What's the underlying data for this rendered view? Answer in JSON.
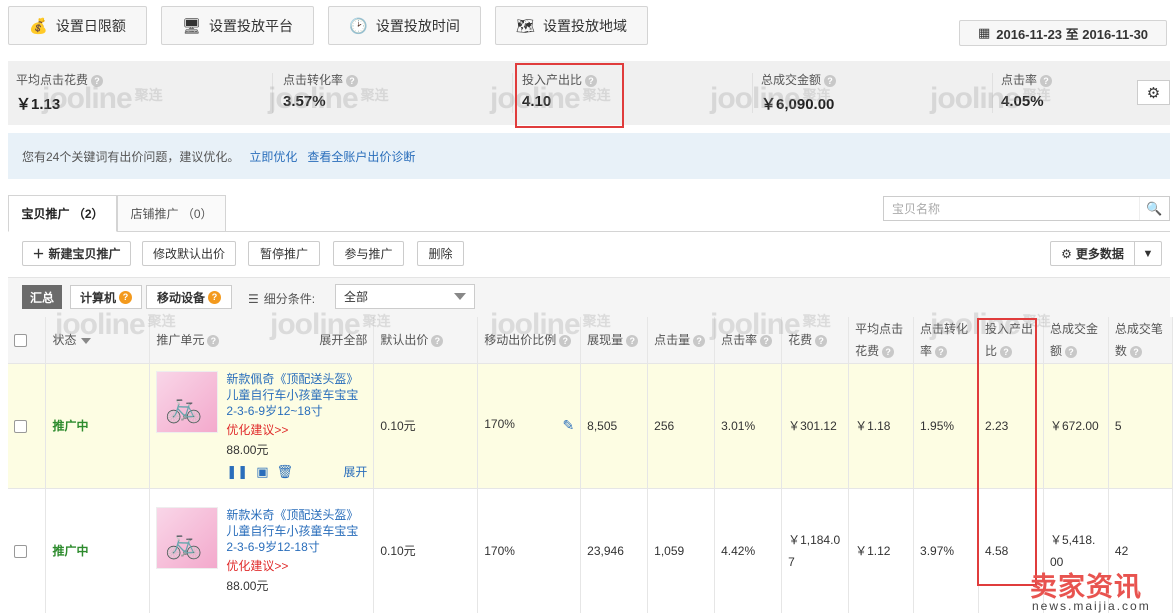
{
  "toolbar": {
    "buttons": [
      {
        "label": "设置日限额",
        "icon": "money-bag-icon"
      },
      {
        "label": "设置投放平台",
        "icon": "monitor-icon"
      },
      {
        "label": "设置投放时间",
        "icon": "clock-icon"
      },
      {
        "label": "设置投放地域",
        "icon": "map-icon"
      }
    ],
    "date_range": "2016-11-23 至 2016-11-30"
  },
  "metrics": [
    {
      "label": "平均点击花费",
      "value": "￥1.13"
    },
    {
      "label": "点击转化率",
      "value": "3.57%"
    },
    {
      "label": "投入产出比",
      "value": "4.10"
    },
    {
      "label": "总成交金额",
      "value": "￥6,090.00"
    },
    {
      "label": "点击率",
      "value": "4.05%"
    }
  ],
  "watermark": {
    "brand": "jooline",
    "cn": "聚连"
  },
  "notice": {
    "text": "您有24个关键词有出价问题，建议优化。",
    "link1": "立即优化",
    "link2": "查看全账户出价诊断"
  },
  "tabs": [
    {
      "label": "宝贝推广 （2）"
    },
    {
      "label": "店铺推广 （0）"
    }
  ],
  "search": {
    "placeholder": "宝贝名称"
  },
  "actions": {
    "new": "新建宝贝推广",
    "edit_bid": "修改默认出价",
    "pause": "暂停推广",
    "join": "参与推广",
    "delete": "删除",
    "more": "更多数据"
  },
  "filter": {
    "summary": "汇总",
    "computer": "计算机",
    "mobile": "移动设备",
    "cond_label": "细分条件:",
    "cond_value": "全部"
  },
  "table": {
    "headers": {
      "status": "状态",
      "unit": "推广单元",
      "expand_all": "展开全部",
      "default_bid": "默认出价",
      "mobile_ratio": "移动出价比例",
      "impressions": "展现量",
      "clicks": "点击量",
      "ctr": "点击率",
      "cost": "花费",
      "avg_cpc": "平均点击花费",
      "cvr": "点击转化率",
      "roi": "投入产出比",
      "gmv": "总成交金额",
      "orders": "总成交笔数"
    },
    "rows": [
      {
        "status": "推广中",
        "title": "新款佩奇《顶配送头盔》儿童自行车小孩童车宝宝2-3-6-9岁12~18寸",
        "suggest": "优化建议>>",
        "price": "88.00元",
        "expand": "展开",
        "default_bid": "0.10元",
        "mobile_ratio": "170%",
        "impressions": "8,505",
        "clicks": "256",
        "ctr": "3.01%",
        "cost": "￥301.12",
        "avg_cpc": "￥1.18",
        "cvr": "1.95%",
        "roi": "2.23",
        "gmv": "￥672.00",
        "orders": "5"
      },
      {
        "status": "推广中",
        "title": "新款米奇《顶配送头盔》儿童自行车小孩童车宝宝2-3-6-9岁12-18寸",
        "suggest": "优化建议>>",
        "price": "88.00元",
        "default_bid": "0.10元",
        "mobile_ratio": "170%",
        "impressions": "23,946",
        "clicks": "1,059",
        "ctr": "4.42%",
        "cost": "￥1,184.07",
        "avg_cpc": "￥1.12",
        "cvr": "3.97%",
        "roi": "4.58",
        "gmv": "￥5,418.00",
        "orders": "42"
      }
    ]
  },
  "site_logo": {
    "name": "卖家资讯",
    "url": "news.maijia.com"
  },
  "colors": {
    "accent": "#2a6ebb",
    "highlight": "#e03c3c",
    "status_green": "#2d8b2d",
    "badge_orange": "#f39a1e",
    "row_highlight": "#fdfde3"
  }
}
